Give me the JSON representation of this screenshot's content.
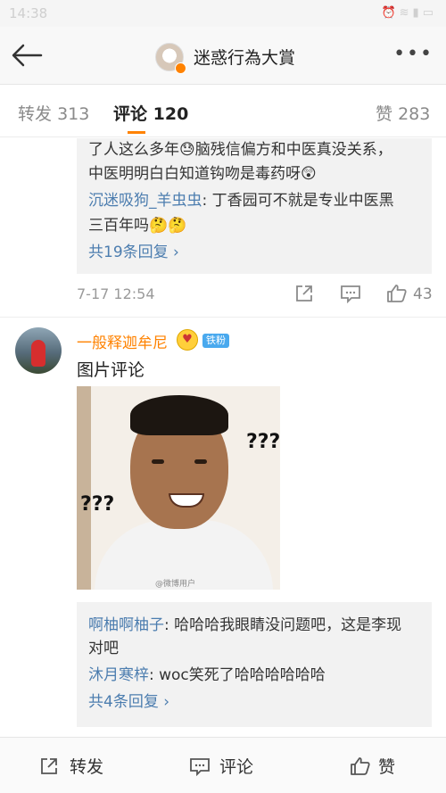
{
  "status_bar": {
    "time": "14:38",
    "icons": [
      "alarm-icon",
      "wifi-icon",
      "signal-icon",
      "battery-icon"
    ]
  },
  "nav": {
    "title": "迷惑行為大賞"
  },
  "tabs": [
    {
      "label": "转发",
      "count": "313"
    },
    {
      "label": "评论",
      "count": "120",
      "active": true
    },
    {
      "label": "赞",
      "count": "283"
    }
  ],
  "prev_comment": {
    "reply_lines": {
      "line1": "了人这么多年😓脑残信偏方和中医真没关系，",
      "line2": "中医明明白白知道钩吻是毒药呀😲",
      "reply_name": "沉迷吸狗_羊虫虫",
      "reply_text1": ": 丁香园可不就是专业中医黑",
      "reply_text2": "三百年吗🤔🤔",
      "more": "共19条回复 ›"
    },
    "time": "7-17 12:54",
    "likes": "43"
  },
  "comment": {
    "username": "一般释迦牟尼",
    "badge": "铁粉",
    "text": "图片评论",
    "photo_marks": {
      "q1": "???",
      "q2": "???",
      "watermark": "@微博用户"
    },
    "replies": [
      {
        "name": "啊柚啊柚子",
        "text1": ": 哈哈哈我眼睛没问题吧，这是李现",
        "text2": "对吧"
      },
      {
        "name": "沐月寒梓",
        "text1": ": woc笑死了哈哈哈哈哈哈"
      }
    ],
    "more": "共4条回复 ›"
  },
  "bottom_bar": {
    "repost": "转发",
    "comment": "评论",
    "like": "赞"
  },
  "colors": {
    "accent": "#ff8200",
    "link": "#4c7daf",
    "reply_bg": "#f2f2f2"
  }
}
